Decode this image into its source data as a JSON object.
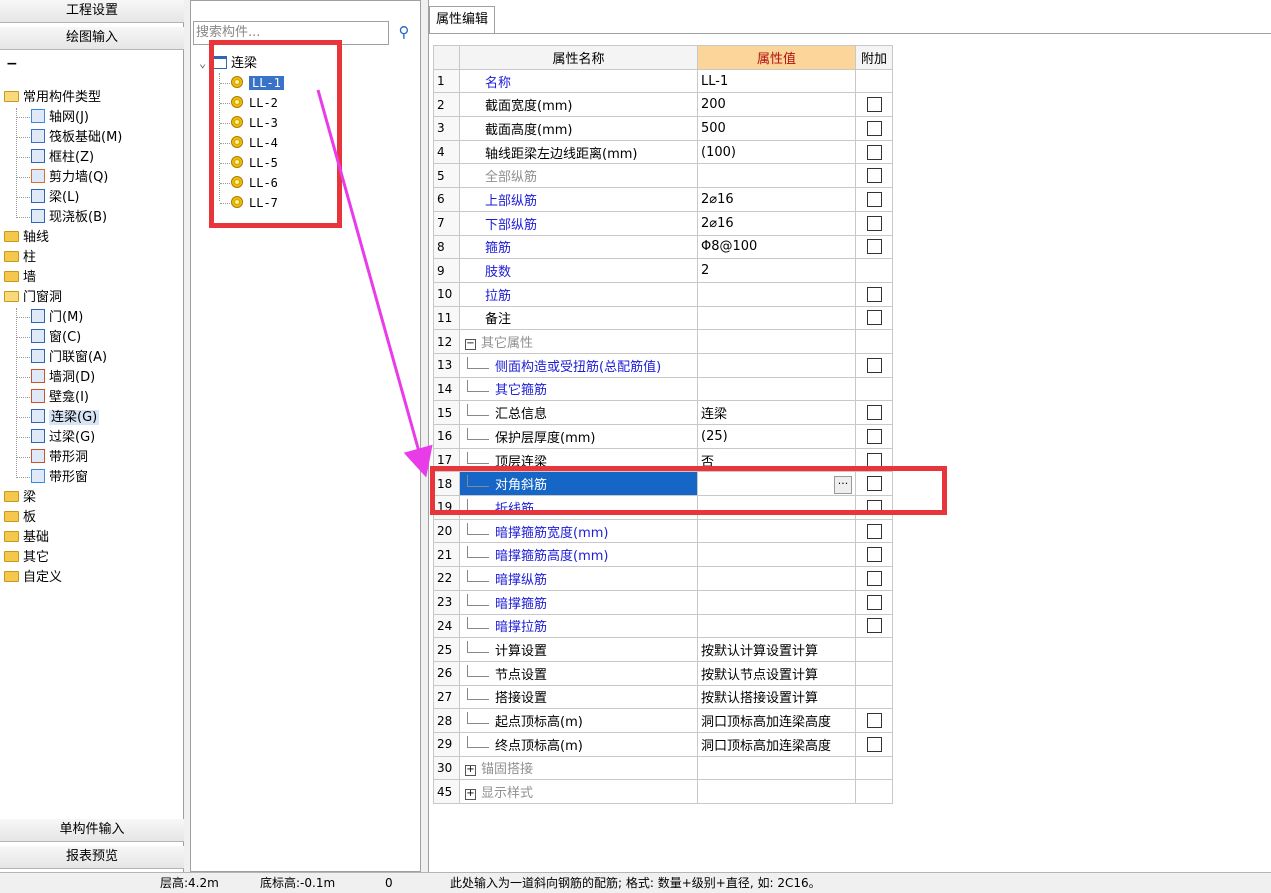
{
  "left_nav": {
    "settings": "工程设置",
    "draw_input": "绘图输入",
    "single_input": "单构件输入",
    "report_preview": "报表预览"
  },
  "left_tree": [
    {
      "label": "常用构件类型",
      "type": "folder-open",
      "level": 0
    },
    {
      "label": "轴网(J)",
      "type": "axis-grid-icon",
      "level": 1
    },
    {
      "label": "筏板基础(M)",
      "type": "raft-icon",
      "level": 1
    },
    {
      "label": "框柱(Z)",
      "type": "column-icon",
      "level": 1
    },
    {
      "label": "剪力墙(Q)",
      "type": "wall-icon",
      "level": 1
    },
    {
      "label": "梁(L)",
      "type": "beam-icon",
      "level": 1
    },
    {
      "label": "现浇板(B)",
      "type": "slab-icon",
      "level": 1
    },
    {
      "label": "轴线",
      "type": "folder",
      "level": 0
    },
    {
      "label": "柱",
      "type": "folder",
      "level": 0
    },
    {
      "label": "墙",
      "type": "folder",
      "level": 0
    },
    {
      "label": "门窗洞",
      "type": "folder-open",
      "level": 0
    },
    {
      "label": "门(M)",
      "type": "door-icon",
      "level": 1
    },
    {
      "label": "窗(C)",
      "type": "window-icon",
      "level": 1
    },
    {
      "label": "门联窗(A)",
      "type": "door-window-icon",
      "level": 1
    },
    {
      "label": "墙洞(D)",
      "type": "wall-hole-icon",
      "level": 1
    },
    {
      "label": "壁龛(I)",
      "type": "niche-icon",
      "level": 1
    },
    {
      "label": "连梁(G)",
      "type": "coupling-beam-icon",
      "level": 1,
      "selected": true
    },
    {
      "label": "过梁(G)",
      "type": "lintel-icon",
      "level": 1
    },
    {
      "label": "带形洞",
      "type": "strip-hole-icon",
      "level": 1
    },
    {
      "label": "带形窗",
      "type": "strip-window-icon",
      "level": 1
    },
    {
      "label": "梁",
      "type": "folder",
      "level": 0
    },
    {
      "label": "板",
      "type": "folder",
      "level": 0
    },
    {
      "label": "基础",
      "type": "folder",
      "level": 0
    },
    {
      "label": "其它",
      "type": "folder",
      "level": 0
    },
    {
      "label": "自定义",
      "type": "folder",
      "level": 0
    }
  ],
  "search": {
    "placeholder": "搜索构件..."
  },
  "component_tree": {
    "root": "连梁",
    "items": [
      "LL-1",
      "LL-2",
      "LL-3",
      "LL-4",
      "LL-5",
      "LL-6",
      "LL-7"
    ],
    "selected": "LL-1"
  },
  "property_tab": "属性编辑",
  "grid": {
    "headers": {
      "name": "属性名称",
      "value": "属性值",
      "extra": "附加"
    },
    "rows": [
      {
        "num": "1",
        "name": "名称",
        "value": "LL-1",
        "style": "blue",
        "check": false,
        "indent": false
      },
      {
        "num": "2",
        "name": "截面宽度(mm)",
        "value": "200",
        "style": "",
        "check": true,
        "indent": false
      },
      {
        "num": "3",
        "name": "截面高度(mm)",
        "value": "500",
        "style": "",
        "check": true,
        "indent": false
      },
      {
        "num": "4",
        "name": "轴线距梁左边线距离(mm)",
        "value": "(100)",
        "style": "",
        "check": true,
        "indent": false
      },
      {
        "num": "5",
        "name": "全部纵筋",
        "value": "",
        "style": "gray",
        "check": true,
        "indent": false
      },
      {
        "num": "6",
        "name": "上部纵筋",
        "value": "2⌀16",
        "style": "blue",
        "check": true,
        "indent": false
      },
      {
        "num": "7",
        "name": "下部纵筋",
        "value": "2⌀16",
        "style": "blue",
        "check": true,
        "indent": false
      },
      {
        "num": "8",
        "name": "箍筋",
        "value": "Φ8@100",
        "style": "blue",
        "check": true,
        "indent": false
      },
      {
        "num": "9",
        "name": "肢数",
        "value": "2",
        "style": "blue",
        "check": false,
        "indent": false
      },
      {
        "num": "10",
        "name": "拉筋",
        "value": "",
        "style": "blue",
        "check": true,
        "indent": false
      },
      {
        "num": "11",
        "name": "备注",
        "value": "",
        "style": "",
        "check": true,
        "indent": false
      },
      {
        "num": "12",
        "name": "其它属性",
        "value": "",
        "style": "gray",
        "check": false,
        "indent": false,
        "toggle": "−"
      },
      {
        "num": "13",
        "name": "侧面构造或受扭筋(总配筋值)",
        "value": "",
        "style": "blue",
        "check": true,
        "indent": true
      },
      {
        "num": "14",
        "name": "其它箍筋",
        "value": "",
        "style": "blue",
        "check": false,
        "indent": true
      },
      {
        "num": "15",
        "name": "汇总信息",
        "value": "连梁",
        "style": "",
        "check": true,
        "indent": true
      },
      {
        "num": "16",
        "name": "保护层厚度(mm)",
        "value": "(25)",
        "style": "",
        "check": true,
        "indent": true
      },
      {
        "num": "17",
        "name": "顶层连梁",
        "value": "否",
        "style": "",
        "check": true,
        "indent": true
      },
      {
        "num": "18",
        "name": "对角斜筋",
        "value": "",
        "style": "",
        "check": true,
        "indent": true,
        "selected": true
      },
      {
        "num": "19",
        "name": "折线筋",
        "value": "",
        "style": "blue",
        "check": true,
        "indent": true
      },
      {
        "num": "20",
        "name": "暗撑箍筋宽度(mm)",
        "value": "",
        "style": "blue",
        "check": true,
        "indent": true
      },
      {
        "num": "21",
        "name": "暗撑箍筋高度(mm)",
        "value": "",
        "style": "blue",
        "check": true,
        "indent": true
      },
      {
        "num": "22",
        "name": "暗撑纵筋",
        "value": "",
        "style": "blue",
        "check": true,
        "indent": true
      },
      {
        "num": "23",
        "name": "暗撑箍筋",
        "value": "",
        "style": "blue",
        "check": true,
        "indent": true
      },
      {
        "num": "24",
        "name": "暗撑拉筋",
        "value": "",
        "style": "blue",
        "check": true,
        "indent": true
      },
      {
        "num": "25",
        "name": "计算设置",
        "value": "按默认计算设置计算",
        "style": "",
        "check": false,
        "indent": true
      },
      {
        "num": "26",
        "name": "节点设置",
        "value": "按默认节点设置计算",
        "style": "",
        "check": false,
        "indent": true
      },
      {
        "num": "27",
        "name": "搭接设置",
        "value": "按默认搭接设置计算",
        "style": "",
        "check": false,
        "indent": true
      },
      {
        "num": "28",
        "name": "起点顶标高(m)",
        "value": "洞口顶标高加连梁高度",
        "style": "",
        "check": true,
        "indent": true
      },
      {
        "num": "29",
        "name": "终点顶标高(m)",
        "value": "洞口顶标高加连梁高度",
        "style": "",
        "check": true,
        "indent": true
      },
      {
        "num": "30",
        "name": "锚固搭接",
        "value": "",
        "style": "gray",
        "check": false,
        "indent": false,
        "toggle": "+"
      },
      {
        "num": "45",
        "name": "显示样式",
        "value": "",
        "style": "gray",
        "check": false,
        "indent": false,
        "toggle": "+"
      }
    ]
  },
  "status": {
    "floor_height": "层高:4.2m",
    "bottom_elev": "底标高:-0.1m",
    "zero": "0",
    "hint": "此处输入为一道斜向钢筋的配筋; 格式: 数量+级别+直径, 如: 2C16。"
  },
  "colors": {
    "annotation": "#e8353c",
    "arrow": "#e83ce8",
    "selection": "#1666c8"
  }
}
